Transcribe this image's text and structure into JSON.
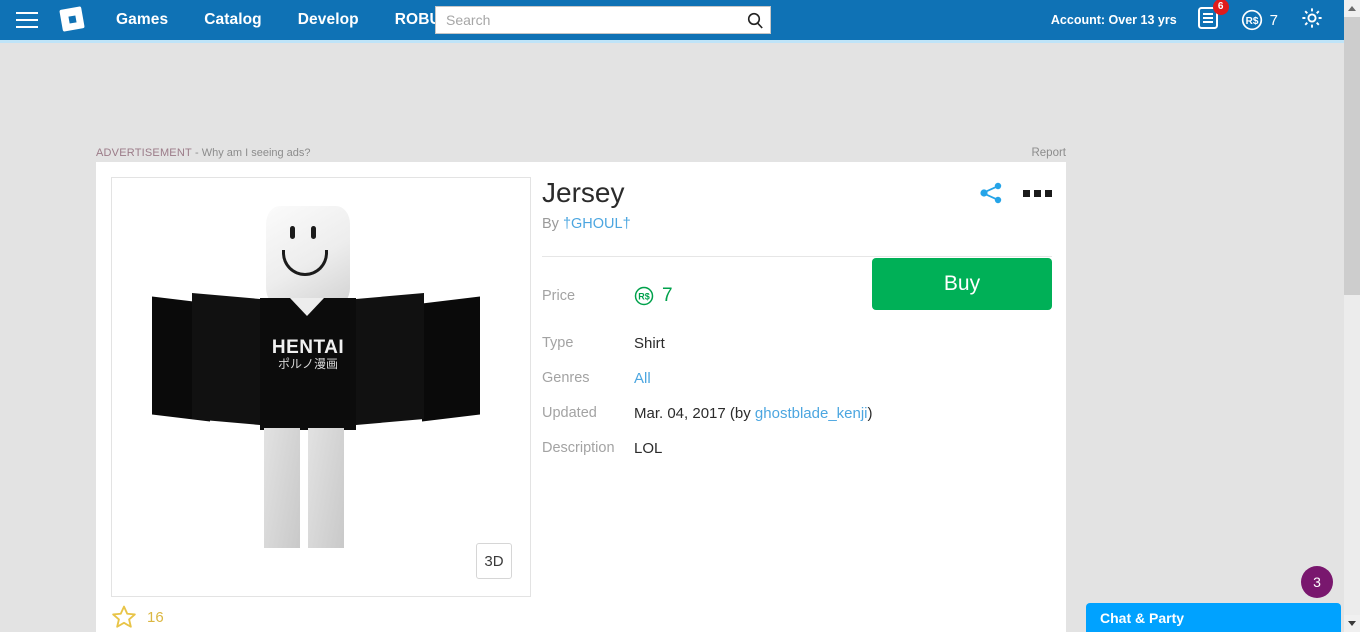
{
  "navbar": {
    "menu_icon": "hamburger-icon",
    "logo_icon": "roblox-logo-icon",
    "links": [
      {
        "label": "Games"
      },
      {
        "label": "Catalog"
      },
      {
        "label": "Develop"
      },
      {
        "label": "ROBUX"
      }
    ],
    "search": {
      "placeholder": "Search",
      "value": "",
      "icon": "search-icon"
    },
    "account_label": "Account: Over 13 yrs",
    "messages": {
      "icon": "messages-icon",
      "badge": "6"
    },
    "robux": {
      "icon": "robux-icon",
      "amount": "7"
    },
    "settings_icon": "gear-icon",
    "background_color": "#0f72b5"
  },
  "ad_bar": {
    "label": "ADVERTISEMENT",
    "separator": " - ",
    "link": "Why am I seeing ads?",
    "report": "Report"
  },
  "item": {
    "title": "Jersey",
    "by_prefix": "By ",
    "creator": "†GHOUL†",
    "share_icon": "share-icon",
    "more_icon": "more-options-icon",
    "price_label": "Price",
    "price_icon": "robux-icon",
    "price_amount": "7",
    "buy_label": "Buy",
    "rows": [
      {
        "label": "Type",
        "value": "Shirt",
        "is_link": false
      },
      {
        "label": "Genres",
        "value": "All",
        "is_link": true
      }
    ],
    "updated": {
      "label": "Updated",
      "date": "Mar. 04, 2017",
      "by_open": " (by ",
      "by_user": "ghostblade_kenji",
      "by_close": ")"
    },
    "description": {
      "label": "Description",
      "value": "LOL"
    },
    "thumbnail": {
      "shirt_text": "HENTAI",
      "shirt_subtext": "ポルノ漫画",
      "view_3d_label": "3D"
    },
    "favorites": {
      "icon": "star-icon",
      "count": "16"
    },
    "accent_buy_color": "#00b057",
    "link_color": "#4ca6e0"
  },
  "chat": {
    "title": "Chat & Party",
    "badge": "3",
    "bar_color": "#00a2ff",
    "badge_color": "#79176e"
  },
  "scrollbar": {
    "up_icon": "scroll-up-arrow-icon",
    "down_icon": "scroll-down-arrow-icon"
  }
}
